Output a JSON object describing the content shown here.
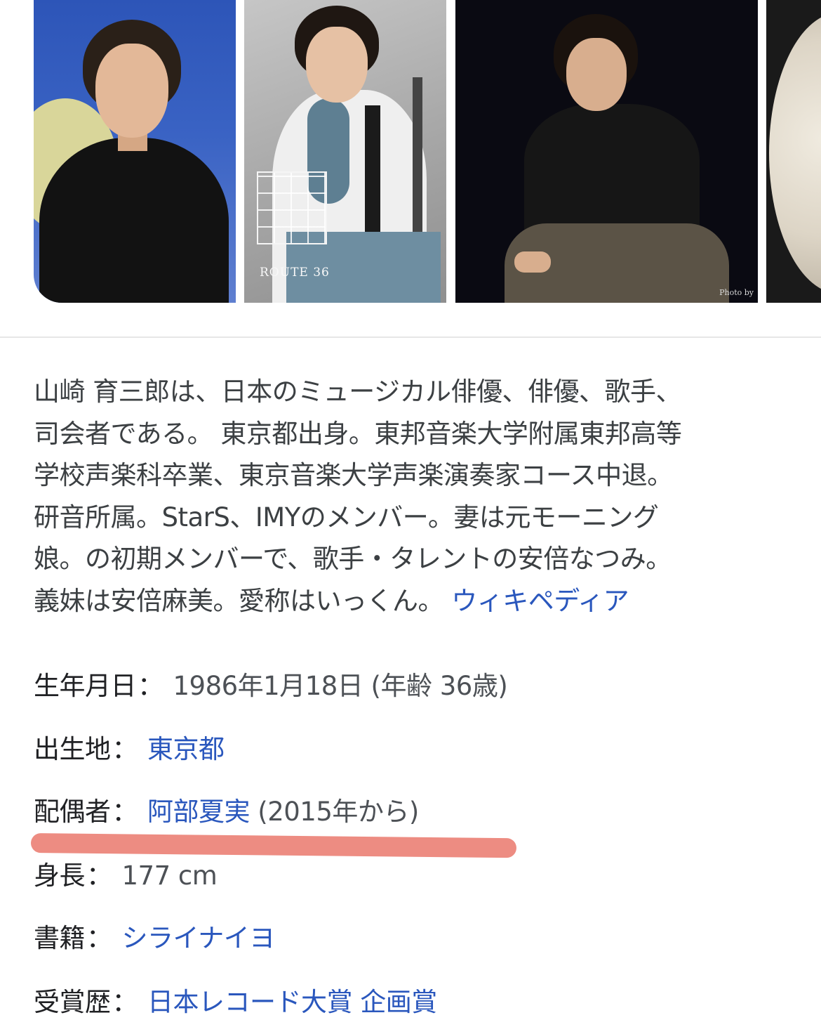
{
  "images": [
    {
      "name": "portrait-blue-background"
    },
    {
      "name": "route36-album-cover",
      "cover_text": "ROUTE 36"
    },
    {
      "name": "portrait-dark-background",
      "credit": "Photo by"
    },
    {
      "name": "partial-round-object"
    }
  ],
  "description": {
    "lines": [
      "山崎 育三郎は、日本のミュージカル俳優、俳優、歌手、",
      "司会者である。 東京都出身。東邦音楽大学附属東邦高等",
      "学校声楽科卒業、東京音楽大学声楽演奏家コース中退。",
      "研音所属。StarS、IMYのメンバー。妻は元モーニング",
      "娘。の初期メンバーで、歌手・タレントの安倍なつみ。",
      "義妹は安倍麻美。愛称はいっくん。"
    ],
    "source_link": "ウィキペディア"
  },
  "facts": {
    "birth": {
      "label": "生年月日",
      "colon": "：",
      "value": "1986年1月18日 (年齢 36歳)"
    },
    "birthplace": {
      "label": "出生地",
      "colon": "：",
      "link": "東京都"
    },
    "spouse": {
      "label": "配偶者",
      "colon": "：",
      "link": "阿部夏実",
      "note": "(2015年から)"
    },
    "height": {
      "label": "身長",
      "colon": "：",
      "value": "177 cm"
    },
    "books": {
      "label": "書籍",
      "colon": "：",
      "link": "シライナイヨ"
    },
    "awards": {
      "label": "受賞歴",
      "colon": "：",
      "link": "日本レコード大賞 企画賞"
    }
  },
  "colors": {
    "link": "#2a57bd",
    "text": "#3c4043",
    "highlight": "#ec8277"
  }
}
